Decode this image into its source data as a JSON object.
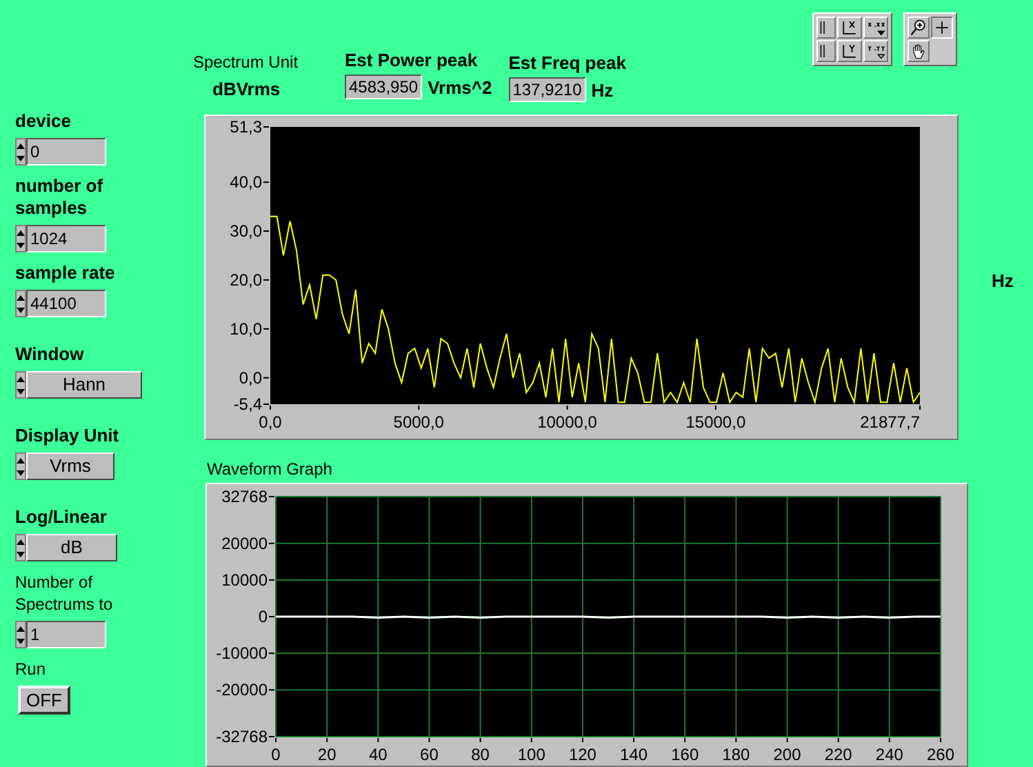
{
  "controls": [
    {
      "kind": "numeric",
      "label": "device",
      "bold": true,
      "value": "0"
    },
    {
      "kind": "numeric",
      "label": "number of samples",
      "bold": true,
      "value": "1024"
    },
    {
      "kind": "numeric",
      "label": "sample rate",
      "bold": true,
      "value": "44100"
    },
    {
      "kind": "ring",
      "label": "Window",
      "bold": true,
      "value": "Hann"
    },
    {
      "kind": "ring",
      "label": "Display Unit",
      "bold": true,
      "value": "Vrms"
    },
    {
      "kind": "ring",
      "label": "Log/Linear",
      "bold": true,
      "value": "dB"
    },
    {
      "kind": "numeric",
      "label": "Number of Spectrums to",
      "bold": false,
      "value": "1"
    },
    {
      "kind": "boolean",
      "label": "Run",
      "bold": false,
      "value": "OFF",
      "on": false
    }
  ],
  "spectrum_unit": {
    "label": "Spectrum Unit",
    "value": "dBVrms"
  },
  "power_peak": {
    "label": "Est Power peak",
    "value": "4583,950",
    "unit": "Vrms^2"
  },
  "freq_peak": {
    "label": "Est Freq peak",
    "value": "137,9210",
    "unit": "Hz"
  },
  "spectrum_graph": {
    "side_unit": "Hz",
    "chart_data": {
      "type": "line",
      "x": [
        0,
        221,
        442,
        663,
        884,
        1105,
        1326,
        1547,
        1768,
        1989,
        2210,
        2431,
        2652,
        2873,
        3094,
        3315,
        3536,
        3757,
        3978,
        4199,
        4420,
        4641,
        4862,
        5083,
        5304,
        5525,
        5746,
        5967,
        6188,
        6409,
        6630,
        6851,
        7072,
        7293,
        7514,
        7735,
        7956,
        8177,
        8398,
        8619,
        8840,
        9061,
        9282,
        9503,
        9724,
        9945,
        10166,
        10387,
        10608,
        10829,
        11050,
        11271,
        11492,
        11713,
        11934,
        12155,
        12376,
        12597,
        12818,
        13039,
        13260,
        13481,
        13702,
        13923,
        14144,
        14365,
        14586,
        14807,
        15028,
        15249,
        15470,
        15691,
        15912,
        16133,
        16354,
        16575,
        16796,
        17017,
        17238,
        17459,
        17680,
        17901,
        18122,
        18343,
        18564,
        18785,
        19006,
        19227,
        19448,
        19669,
        19890,
        20111,
        20332,
        20553,
        20774,
        20995,
        21216,
        21437,
        21658,
        21877.7
      ],
      "xlim": [
        0,
        21877.7
      ],
      "ylim": [
        -5.4,
        51.3
      ],
      "xticks": [
        {
          "value": 0,
          "label": "0,0"
        },
        {
          "value": 5000,
          "label": "5000,0"
        },
        {
          "value": 10000,
          "label": "10000,0"
        },
        {
          "value": 15000,
          "label": "15000,0"
        },
        {
          "value": 21877.7,
          "label": "21877,7"
        }
      ],
      "yticks": [
        {
          "value": -5.4,
          "label": "-5,4"
        },
        {
          "value": 0,
          "label": "0,0"
        },
        {
          "value": 10,
          "label": "10,0"
        },
        {
          "value": 20,
          "label": "20,0"
        },
        {
          "value": 30,
          "label": "30,0"
        },
        {
          "value": 40,
          "label": "40,0"
        },
        {
          "value": 51.3,
          "label": "51,3"
        }
      ],
      "series": [
        {
          "color": "#ffff00",
          "values": [
            33,
            33,
            25,
            32,
            26,
            15,
            19,
            12,
            21,
            21,
            20,
            13,
            9,
            18,
            3,
            7,
            5,
            14,
            10,
            3,
            -1,
            5,
            6,
            2,
            6,
            -2,
            8,
            7,
            3,
            0,
            6,
            -2,
            7,
            2,
            -2,
            4,
            9,
            0,
            5,
            -3,
            -1,
            3,
            -4,
            6,
            -5,
            8,
            -4,
            3,
            -5,
            9,
            6,
            -5,
            8,
            -5,
            -5,
            4,
            1,
            -5,
            -5,
            5,
            -5,
            -3,
            -5,
            -1,
            -5,
            8,
            -2,
            -5,
            -5,
            1,
            -5,
            -3,
            -4,
            6,
            -5,
            6,
            4,
            5,
            -2,
            6,
            -5,
            4,
            -1,
            -5,
            2,
            6,
            -5,
            4,
            -2,
            -5,
            6,
            -5,
            5,
            -5,
            -5,
            3,
            -5,
            2,
            -5,
            -3
          ]
        }
      ]
    }
  },
  "waveform_graph": {
    "title": "Waveform Graph",
    "chart_data": {
      "type": "line",
      "grid": true,
      "x": [
        0,
        10,
        20,
        30,
        40,
        50,
        60,
        70,
        80,
        90,
        100,
        110,
        120,
        130,
        140,
        150,
        160,
        170,
        180,
        190,
        200,
        210,
        220,
        230,
        240,
        250,
        260
      ],
      "xlim": [
        0,
        260
      ],
      "ylim": [
        -32768,
        32768
      ],
      "xticks": [
        0,
        20,
        40,
        60,
        80,
        100,
        120,
        140,
        160,
        180,
        200,
        220,
        240,
        260
      ],
      "yticks": [
        -32768,
        -20000,
        -10000,
        0,
        10000,
        20000,
        32768
      ],
      "series": [
        {
          "color": "#ffffff",
          "values": [
            0,
            0,
            0,
            0,
            -300,
            0,
            -300,
            0,
            -300,
            0,
            0,
            0,
            0,
            -300,
            0,
            0,
            0,
            0,
            0,
            0,
            -300,
            0,
            -300,
            0,
            -300,
            0,
            0
          ]
        }
      ]
    }
  }
}
